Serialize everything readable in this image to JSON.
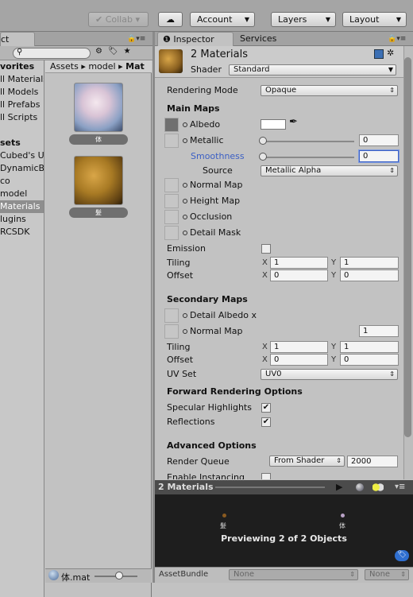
{
  "toolbar": {
    "collab": "✔ Collab ▾",
    "account": "Account",
    "layers": "Layers",
    "layout": "Layout"
  },
  "tabs": {
    "project_left": "ct",
    "inspector": "Inspector",
    "services": "Services"
  },
  "sidebar": {
    "items": [
      "vorites",
      "ll Materials",
      "ll Models",
      "ll Prefabs",
      "ll Scripts",
      "",
      "sets",
      "Cubed's Unity",
      "DynamicBone",
      "co",
      "model",
      "Materials",
      "lugins",
      "RCSDK"
    ]
  },
  "breadcrumb": {
    "assets": "Assets",
    "sep1": "▸",
    "model": "model",
    "sep2": "▸",
    "mat": "Mat"
  },
  "assets": [
    {
      "label": "体"
    },
    {
      "label": "髪"
    }
  ],
  "inspector": {
    "title": "2 Materials",
    "shader_label": "Shader",
    "shader_value": "Standard",
    "rendering_mode_label": "Rendering Mode",
    "rendering_mode_value": "Opaque",
    "main_maps": "Main Maps",
    "albedo": "Albedo",
    "metallic": "Metallic",
    "metallic_value": "0",
    "smoothness": "Smoothness",
    "smoothness_value": "0",
    "source_label": "Source",
    "source_value": "Metallic Alpha",
    "normal_map": "Normal Map",
    "height_map": "Height Map",
    "occlusion": "Occlusion",
    "detail_mask": "Detail Mask",
    "emission": "Emission",
    "tiling": "Tiling",
    "offset": "Offset",
    "x": "X",
    "y": "Y",
    "tiling_x": "1",
    "tiling_y": "1",
    "offset_x": "0",
    "offset_y": "0",
    "secondary_maps": "Secondary Maps",
    "detail_albedo": "Detail Albedo x",
    "normal_map2": "Normal Map",
    "normal_map2_value": "1",
    "tiling2_x": "1",
    "tiling2_y": "1",
    "offset2_x": "0",
    "offset2_y": "0",
    "uv_set_label": "UV Set",
    "uv_set_value": "UV0",
    "forward": "Forward Rendering Options",
    "specular": "Specular Highlights",
    "reflections": "Reflections",
    "advanced": "Advanced Options",
    "render_queue_label": "Render Queue",
    "render_queue_mode": "From Shader",
    "render_queue_value": "2000",
    "instancing": "Enable Instancing"
  },
  "preview": {
    "title": "2 Materials",
    "label_left": "髪",
    "label_right": "体",
    "status": "Previewing 2 of 2 Objects"
  },
  "bundle": {
    "label": "AssetBundle",
    "value1": "None",
    "value2": "None"
  },
  "footer": {
    "file": "体.mat"
  },
  "colors": {
    "bg": "#c2c2c2",
    "dark": "#1e1e1e",
    "accent": "#3b5fc4"
  }
}
